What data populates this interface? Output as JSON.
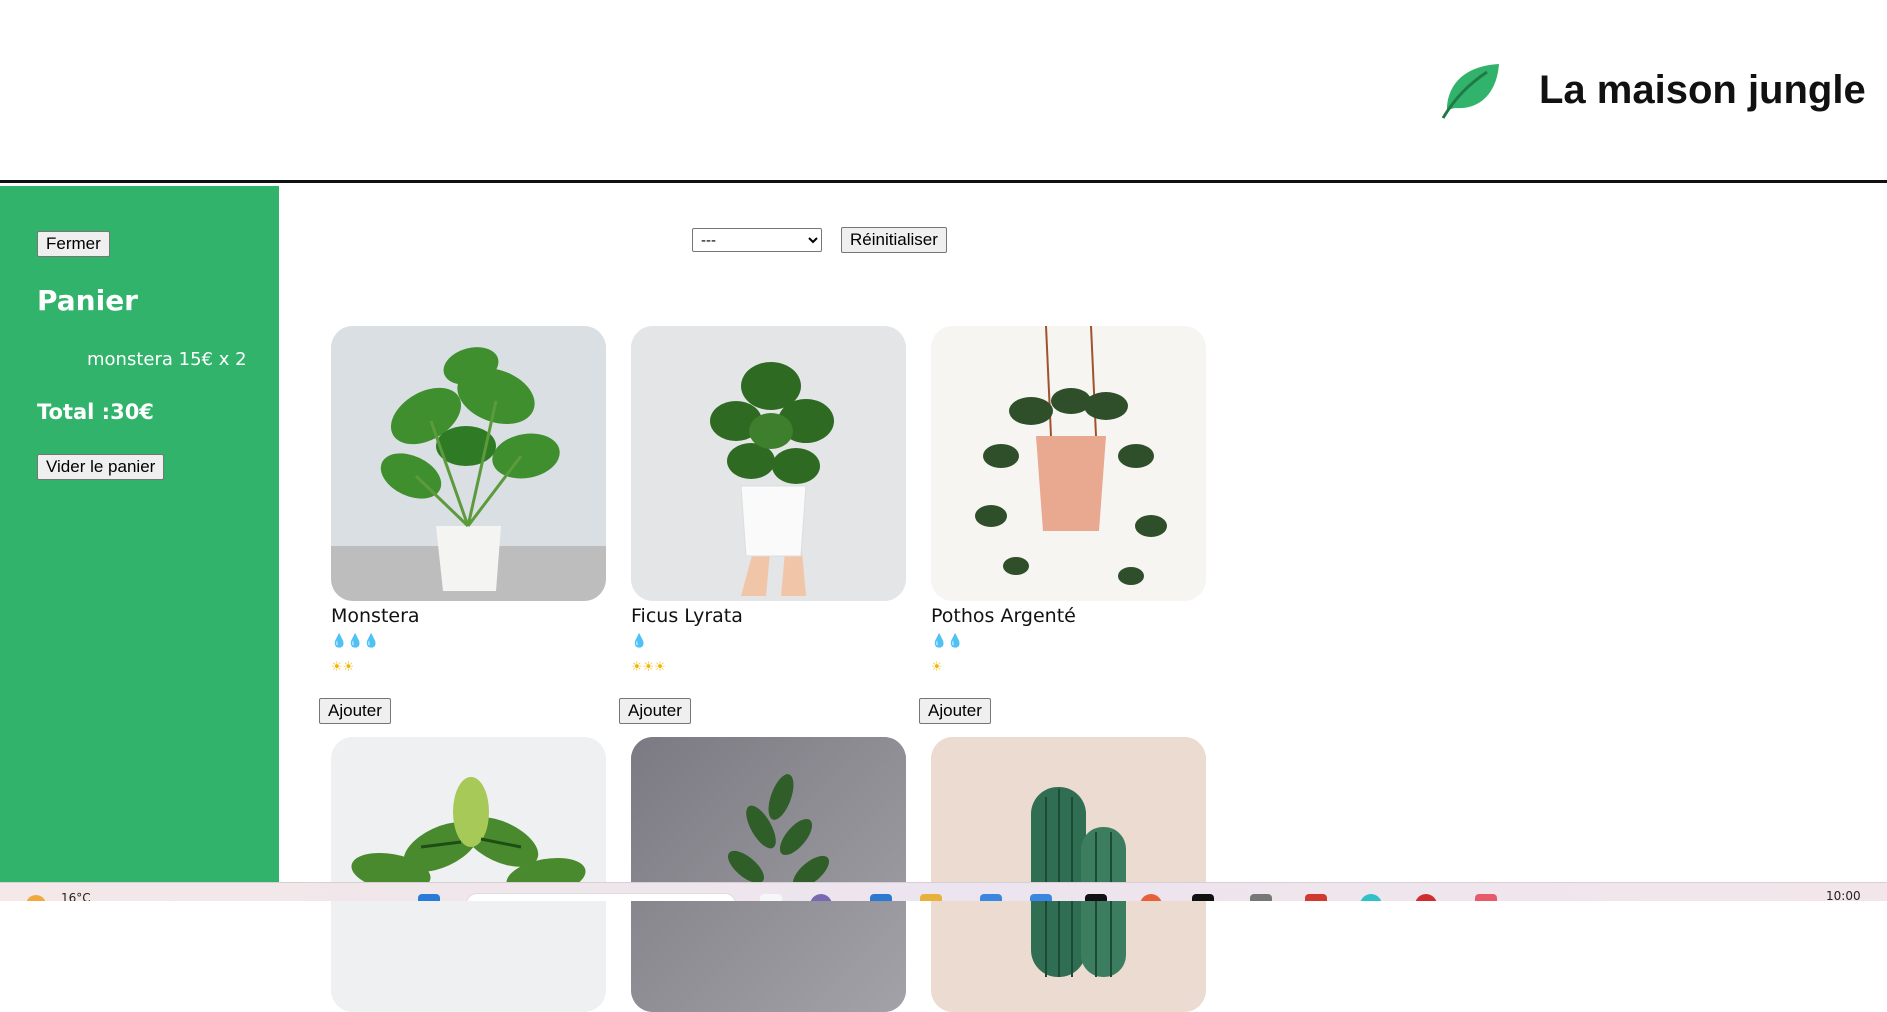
{
  "header": {
    "title": "La maison jungle",
    "logo_icon": "leaf-icon",
    "leaf_color": "#31b36b"
  },
  "cart": {
    "close_label": "Fermer",
    "title": "Panier",
    "items": [
      {
        "text": "monstera 15€ x 2"
      }
    ],
    "total_text": "Total :30€",
    "empty_label": "Vider le panier",
    "background_color": "#31b36b"
  },
  "filter": {
    "selected": "---",
    "reset_label": "Réinitialiser"
  },
  "plants": [
    {
      "name": "Monstera",
      "water": "💧💧💧",
      "light": "☀☀",
      "add_label": "Ajouter",
      "image": "monstera-photo"
    },
    {
      "name": "Ficus Lyrata",
      "water": "💧",
      "light": "☀☀☀",
      "add_label": "Ajouter",
      "image": "ficus-lyrata-photo"
    },
    {
      "name": "Pothos Argenté",
      "water": "💧💧",
      "light": "☀",
      "add_label": "Ajouter",
      "image": "pothos-argente-photo"
    },
    {
      "image": "calathea-photo"
    },
    {
      "image": "olivier-photo"
    },
    {
      "image": "cactus-photo"
    }
  ],
  "taskbar": {
    "weather": "16°C",
    "clock": "10:00"
  }
}
